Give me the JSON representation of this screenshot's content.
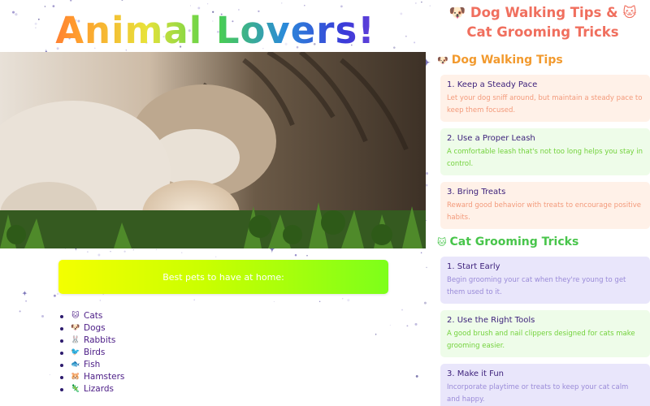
{
  "left": {
    "title": "Animal Lovers!",
    "banner_text": "Best pets to have at home:",
    "pets": [
      {
        "icon": "cat-face-icon",
        "emoji": "🐱",
        "label": "Cats"
      },
      {
        "icon": "dog-face-icon",
        "emoji": "🐶",
        "label": "Dogs"
      },
      {
        "icon": "rabbit-face-icon",
        "emoji": "🐰",
        "label": "Rabbits"
      },
      {
        "icon": "bird-icon",
        "emoji": "🐦",
        "label": "Birds"
      },
      {
        "icon": "fish-icon",
        "emoji": "🐟",
        "label": "Fish"
      },
      {
        "icon": "hamster-face-icon",
        "emoji": "🐹",
        "label": "Hamsters"
      },
      {
        "icon": "lizard-icon",
        "emoji": "🦎",
        "label": "Lizards"
      }
    ]
  },
  "right": {
    "title": "🐶 Dog Walking Tips & 🐱 Cat Grooming Tricks",
    "dog_section": {
      "emoji": "🐶",
      "heading": "Dog Walking Tips",
      "tips": [
        {
          "title": "1. Keep a Steady Pace",
          "desc": "Let your dog sniff around, but maintain a steady pace to keep them focused."
        },
        {
          "title": "2. Use a Proper Leash",
          "desc": "A comfortable leash that's not too long helps you stay in control."
        },
        {
          "title": "3. Bring Treats",
          "desc": "Reward good behavior with treats to encourage positive habits."
        }
      ]
    },
    "cat_section": {
      "emoji": "🐱",
      "heading": "Cat Grooming Tricks",
      "tips": [
        {
          "title": "1. Start Early",
          "desc": "Begin grooming your cat when they're young to get them used to it."
        },
        {
          "title": "2. Use the Right Tools",
          "desc": "A good brush and nail clippers designed for cats make grooming easier."
        },
        {
          "title": "3. Make it Fun",
          "desc": "Incorporate playtime or treats to keep your cat calm and happy."
        }
      ]
    }
  },
  "colors": {
    "accent_coral": "#f06f5e",
    "accent_orange": "#f29a2e",
    "accent_green": "#48c54b",
    "purple_text": "#3b1f7a"
  }
}
